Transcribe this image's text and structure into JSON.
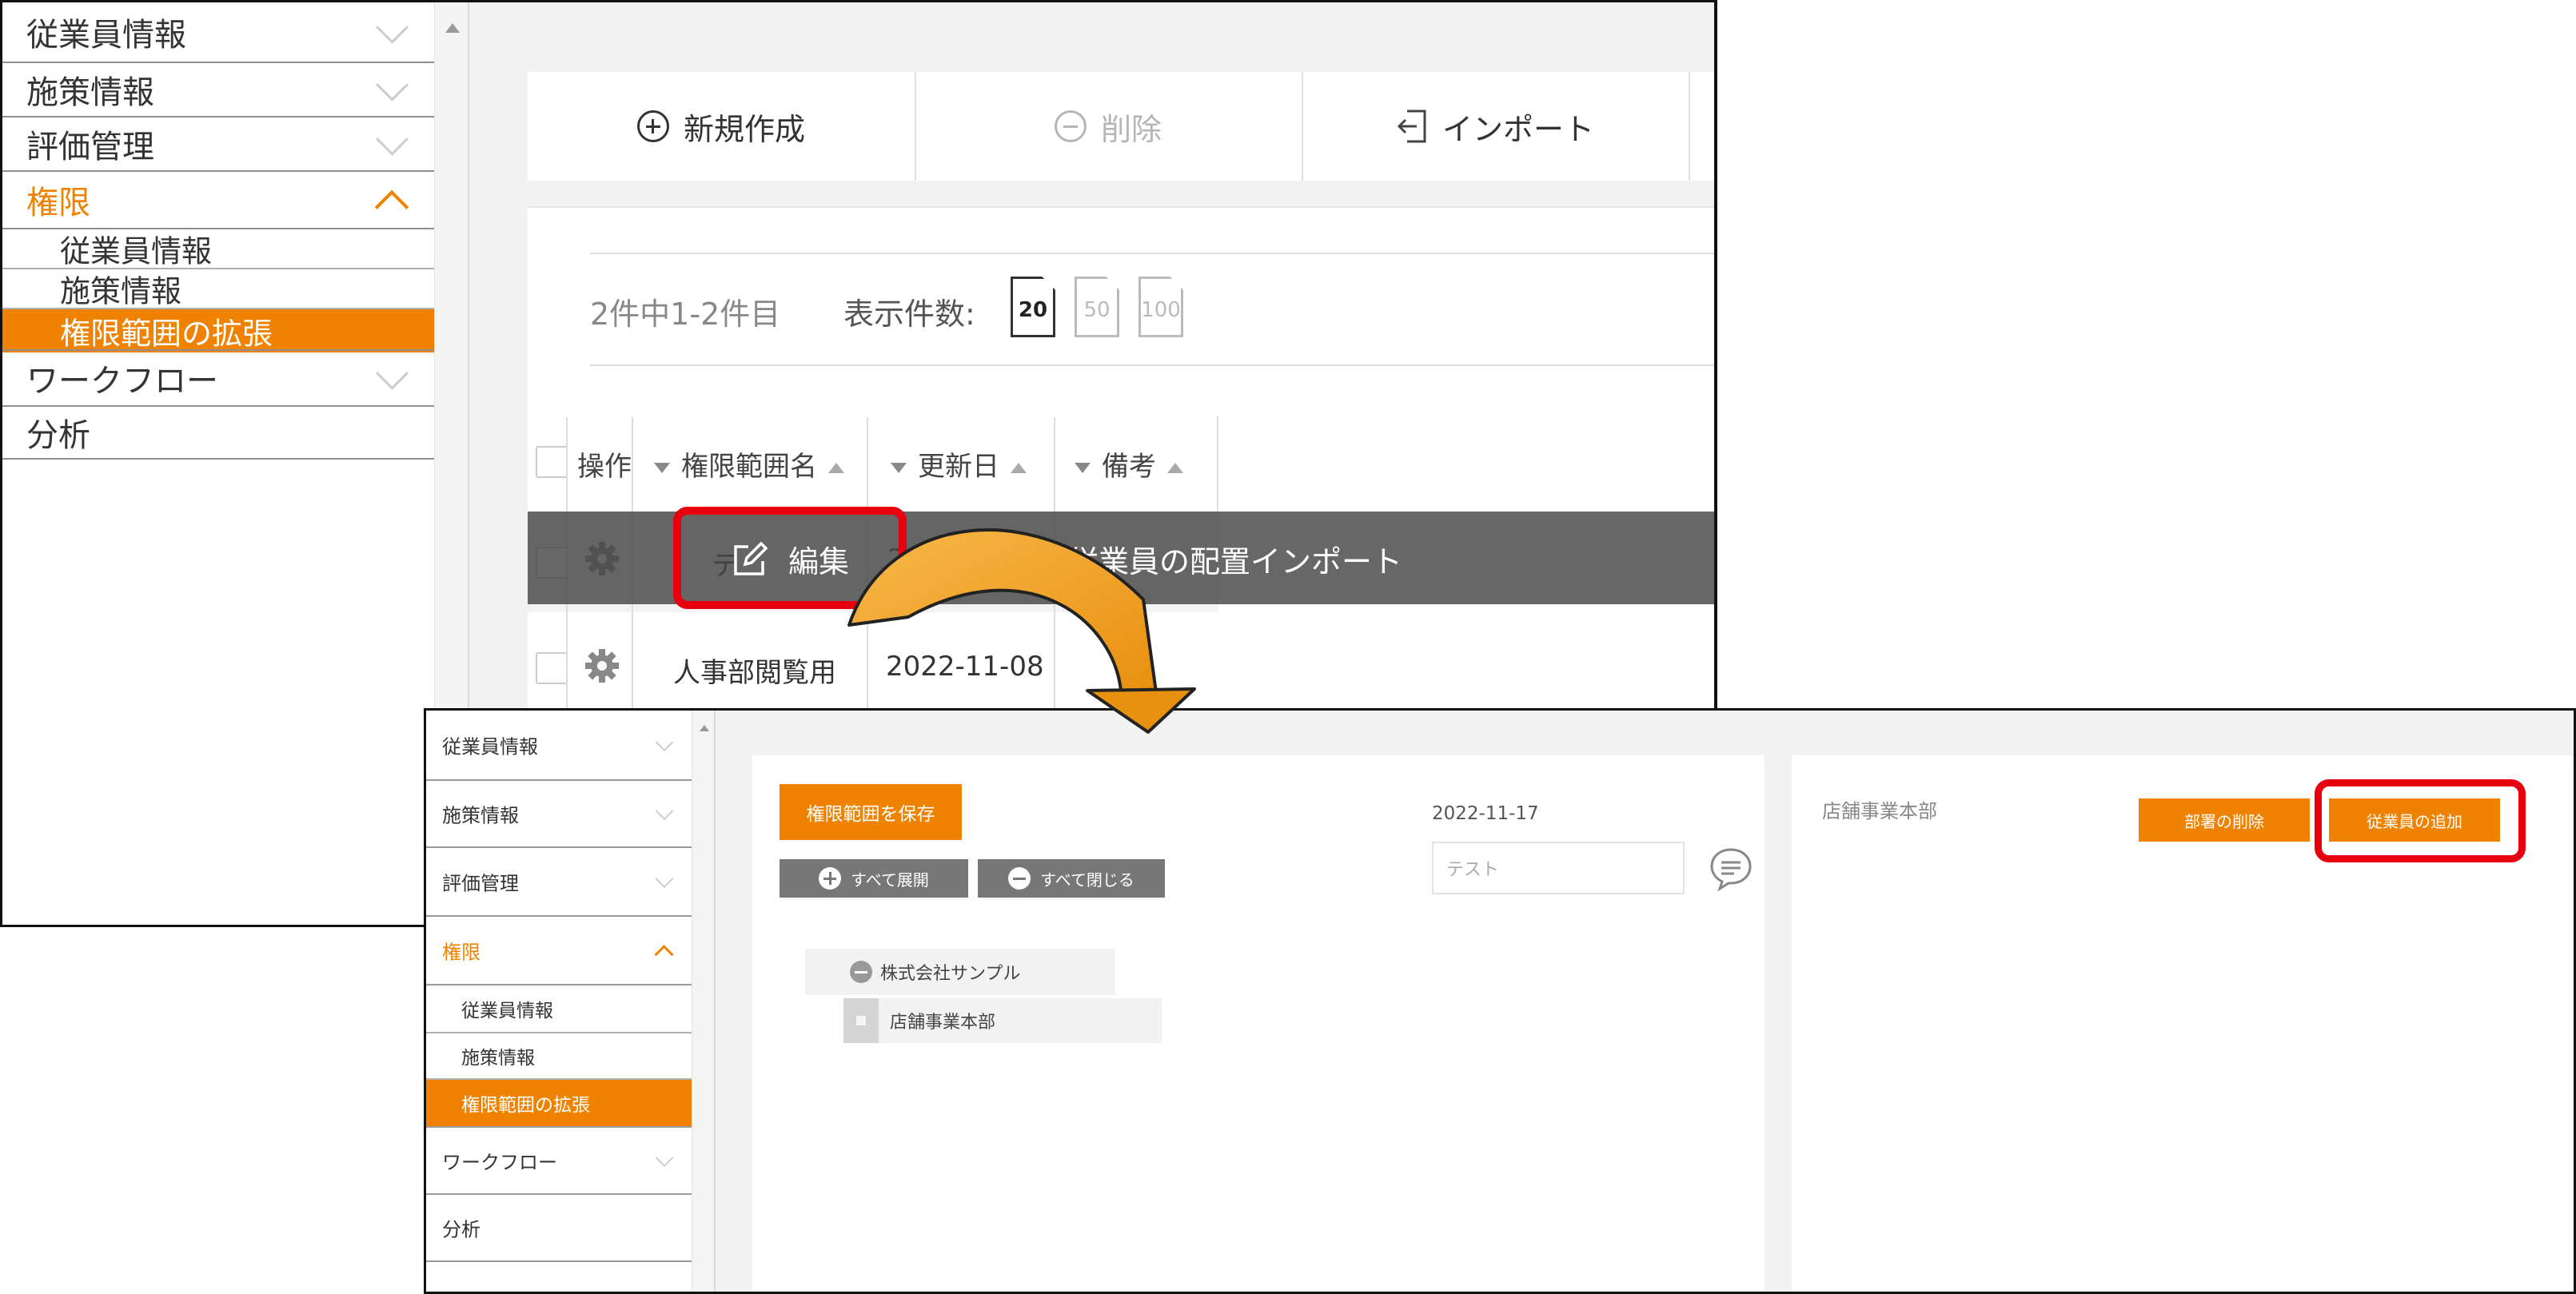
{
  "colors": {
    "accent": "#ef8200",
    "highlight_box": "#e8000f",
    "arrow_fill": "#f5a623",
    "gray_button": "#777777"
  },
  "screenshot1": {
    "sidebar": {
      "items": [
        {
          "label": "従業員情報",
          "state": "collapsed"
        },
        {
          "label": "施策情報",
          "state": "collapsed"
        },
        {
          "label": "評価管理",
          "state": "collapsed"
        },
        {
          "label": "権限",
          "state": "expanded"
        },
        {
          "label": "ワークフロー",
          "state": "collapsed"
        },
        {
          "label": "分析",
          "state": "none"
        }
      ],
      "subitems": [
        {
          "label": "従業員情報",
          "active": false
        },
        {
          "label": "施策情報",
          "active": false
        },
        {
          "label": "権限範囲の拡張",
          "active": true
        }
      ]
    },
    "toolbar": {
      "new_label": "新規作成",
      "delete_label": "削除",
      "import_label": "インポート"
    },
    "list": {
      "count_text": "2件中1-2件目",
      "per_page_label": "表示件数:",
      "per_page_options": [
        "20",
        "50",
        "100"
      ],
      "per_page_selected": "20"
    },
    "table": {
      "headers": {
        "action": "操作",
        "name": "権限範囲名",
        "updated": "更新日",
        "remarks": "備考"
      },
      "rows": [
        {
          "name": "テ",
          "updated": "2022-11-1"
        },
        {
          "name": "人事部閲覧用",
          "updated": "2022-11-08"
        }
      ]
    },
    "context_menu": {
      "edit_label": "編集",
      "import_label": "従業員の配置インポート"
    }
  },
  "screenshot2": {
    "sidebar": {
      "items": [
        {
          "label": "従業員情報",
          "state": "collapsed"
        },
        {
          "label": "施策情報",
          "state": "collapsed"
        },
        {
          "label": "評価管理",
          "state": "collapsed"
        },
        {
          "label": "権限",
          "state": "expanded"
        },
        {
          "label": "ワークフロー",
          "state": "collapsed"
        },
        {
          "label": "分析",
          "state": "none"
        }
      ],
      "subitems": [
        {
          "label": "従業員情報",
          "active": false
        },
        {
          "label": "施策情報",
          "active": false
        },
        {
          "label": "権限範囲の拡張",
          "active": true
        }
      ]
    },
    "editor": {
      "save_label": "権限範囲を保存",
      "expand_all_label": "すべて展開",
      "collapse_all_label": "すべて閉じる",
      "date": "2022-11-17",
      "note_value": "テスト"
    },
    "tree": {
      "root": "株式会社サンプル",
      "child": "店舗事業本部"
    },
    "dept_panel": {
      "title": "店舗事業本部",
      "delete_dept_label": "部署の削除",
      "add_employee_label": "従業員の追加"
    }
  }
}
